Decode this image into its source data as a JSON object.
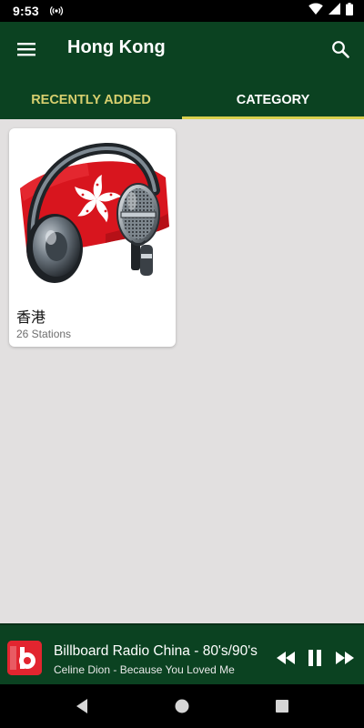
{
  "status_bar": {
    "time": "9:53",
    "icons": [
      "radio-broadcast-icon",
      "wifi-icon",
      "signal-icon",
      "battery-icon"
    ]
  },
  "app_bar": {
    "title": "Hong Kong",
    "menu_icon": "hamburger-menu-icon",
    "search_icon": "search-icon",
    "background": "#0b4221"
  },
  "tabs": [
    {
      "label": "RECENTLY ADDED",
      "selected": false
    },
    {
      "label": "CATEGORY",
      "selected": true
    }
  ],
  "colors": {
    "accent": "#d9d04e",
    "inactive_tab": "#d7cf6e",
    "content_bg": "#e2e0e0"
  },
  "categories": [
    {
      "title": "香港",
      "subtitle": "26 Stations",
      "image": "hong-kong-flag-headphones-microphone"
    }
  ],
  "player": {
    "logo": "billboard-logo",
    "title": "Billboard Radio China - 80's/90's",
    "subtitle": "Celine Dion - Because You Loved Me",
    "controls": [
      "rewind-icon",
      "pause-icon",
      "fast-forward-icon"
    ]
  },
  "nav_bar": {
    "buttons": [
      "back-icon",
      "home-icon",
      "recents-icon"
    ]
  }
}
